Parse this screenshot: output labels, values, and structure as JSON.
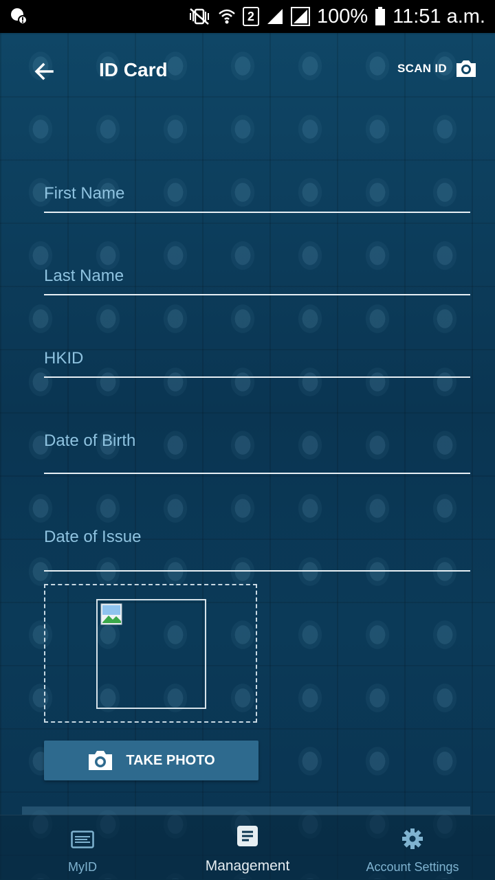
{
  "status_bar": {
    "sim": "2",
    "battery": "100%",
    "time": "11:51 a.m."
  },
  "app_bar": {
    "title": "ID Card",
    "scan_label": "SCAN ID"
  },
  "form": {
    "fields": [
      {
        "label": "First Name",
        "value": ""
      },
      {
        "label": "Last Name",
        "value": ""
      },
      {
        "label": "HKID",
        "value": ""
      },
      {
        "label": "Date of Birth",
        "value": ""
      },
      {
        "label": "Date of Issue",
        "value": ""
      }
    ],
    "take_photo_label": "TAKE PHOTO"
  },
  "bottom_nav": {
    "items": [
      {
        "label": "MyID",
        "icon": "id-card-icon",
        "active": false
      },
      {
        "label": "Management",
        "icon": "document-list-icon",
        "active": true
      },
      {
        "label": "Account Settings",
        "icon": "gear-icon",
        "active": false
      }
    ]
  },
  "colors": {
    "background": "#0b3550",
    "accent_button": "#2e6a8e",
    "label": "#8fc3e0",
    "nav_active": "#e6eef2",
    "nav_inactive": "#7fb3d0"
  }
}
